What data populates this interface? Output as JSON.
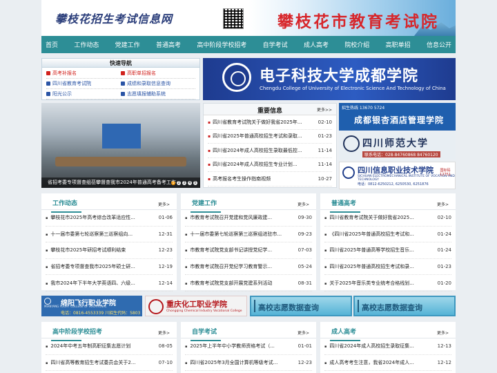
{
  "header": {
    "logo_text": "攀枝花招生考试信息网",
    "banner_title": "攀枝花市教育考试院"
  },
  "nav": [
    "首页",
    "工作动态",
    "党建工作",
    "普通高考",
    "高中阶段学校招考",
    "自学考试",
    "成人高考",
    "院校介绍",
    "高职单招",
    "信息公开"
  ],
  "quick_nav": {
    "title": "快速导航",
    "items": [
      {
        "label": "高考补报名",
        "style": "red",
        "color": "#d1211c"
      },
      {
        "label": "高职单招报名",
        "style": "red",
        "color": "#d1211c"
      },
      {
        "label": "四川省教育考试院",
        "style": "blue",
        "color": "#2a54a5"
      },
      {
        "label": "成绩和录取信息查询",
        "style": "blue",
        "color": "#2a54a5"
      },
      {
        "label": "阳光公示",
        "style": "blue",
        "color": "#2a54a5"
      },
      {
        "label": "志愿填报辅助系统",
        "style": "blue",
        "color": "#2a54a5"
      }
    ]
  },
  "uestc_ad": {
    "name": "电子科技大学成都学院",
    "english": "Chengdu College of University of Electronic Science And Technology of China"
  },
  "slideshow": {
    "caption": "省招考委专项督查组莅攀督查我市2024年普通高考备考工作",
    "dots": [
      "1",
      "2",
      "3",
      "4",
      "5"
    ],
    "active": 0
  },
  "important_news": {
    "title": "重要信息",
    "more": "更多>>",
    "items": [
      {
        "title": "四川省教育考试院关于做好我省2025年...",
        "date": "02-10"
      },
      {
        "title": "四川省2025年普通高校招生考试和录取...",
        "date": "01-23"
      },
      {
        "title": "四川省2024年成人高校招生录取最低控...",
        "date": "11-14"
      },
      {
        "title": "四川省2024年成人高校招生专业计划...",
        "date": "11-14"
      },
      {
        "title": "高考报名考生操作指南视频",
        "date": "10-27"
      }
    ]
  },
  "side_ads": {
    "yinxing": {
      "line1": "招生热线 13670    5724",
      "line2": "成都银杏酒店管理学院"
    },
    "sichuan_normal": {
      "line1": "四川师范大学",
      "line2": "联系电话：028-84760868  84760120"
    },
    "sichuan_elec": {
      "line1": "四川信息职业技术学院",
      "line2": "SICHUAN ELECTROMECHANICAL INSTITUTE OF VOCATION AND TECHNOLOGY",
      "line3": "电话：0812-6250212, 6250530, 6251876",
      "line4": "国标码 12751"
    }
  },
  "columns_top": [
    {
      "title": "工作动态",
      "more": "更多>",
      "items": [
        {
          "title": "攀枝花市2025年高考综合改革适应性...",
          "date": "01-06"
        },
        {
          "title": "十一届市委第七轮巡察第三巡察组向...",
          "date": "12-31"
        },
        {
          "title": "攀枝花市2025年研招考试顺利结束",
          "date": "12-23"
        },
        {
          "title": "省招考委专项督查我市2025年硕士研...",
          "date": "12-19"
        },
        {
          "title": "我市2024年下半年大学英语四、六级...",
          "date": "12-14"
        }
      ]
    },
    {
      "title": "党建工作",
      "more": "更多>",
      "items": [
        {
          "title": "市教育考试院召开党建和党风廉政建...",
          "date": "09-30"
        },
        {
          "title": "十一届市委第七轮巡察第三巡察组进驻市...",
          "date": "09-23"
        },
        {
          "title": "市教育考试院党支部书记讲授党纪学...",
          "date": "07-03"
        },
        {
          "title": "市教育考试院召开党纪学习教育警示...",
          "date": "05-24"
        },
        {
          "title": "市教育考试院党支部开展党建系列活动",
          "date": "08-31"
        }
      ]
    },
    {
      "title": "普通高考",
      "more": "更多>",
      "items": [
        {
          "title": "四川省教育考试院关于做好我省2025...",
          "date": "02-10"
        },
        {
          "title": "《四川省2025年普通高校招生考试和...",
          "date": "01-24"
        },
        {
          "title": "四川省2025年普通高等学校招生音乐...",
          "date": "01-24"
        },
        {
          "title": "四川省2025年普通高校招生考试和录...",
          "date": "01-23"
        },
        {
          "title": "关于2025年音乐类专业统考合格线划...",
          "date": "01-20"
        }
      ]
    }
  ],
  "ad_strip": {
    "mianyang": {
      "line1": "绵阳飞行职业学院",
      "line2": "MIANYANG FLIGHT COLLEGE OF VOCATIONAL",
      "line3": "电话：0816-4553339 川招生代码：5803"
    },
    "chemical": {
      "line1": "重庆化工职业学院",
      "line2": "Chongqing Chemical Industry Vocational College"
    },
    "query1": "高校志愿数据查询",
    "query2": "高校志愿数据查询"
  },
  "columns_bottom": [
    {
      "title": "高中阶段学校招考",
      "more": "更多>",
      "items": [
        {
          "title": "2024年中考五年制高职征集志愿计划",
          "date": "08-05"
        },
        {
          "title": "四川省高等教育招生考试委员会关于2...",
          "date": "07-10"
        }
      ]
    },
    {
      "title": "自学考试",
      "more": "更多>",
      "items": [
        {
          "title": "2025年上半年中小学教师资格考试（...",
          "date": "01-01"
        },
        {
          "title": "四川省2025年3月全国计算机等级考试...",
          "date": "12-23"
        }
      ]
    },
    {
      "title": "成人高考",
      "more": "更多>",
      "items": [
        {
          "title": "四川省2024年成人高校招生录取征集...",
          "date": "12-13"
        },
        {
          "title": "成人高考考生注意，我省2024年成人...",
          "date": "12-12"
        }
      ]
    }
  ]
}
